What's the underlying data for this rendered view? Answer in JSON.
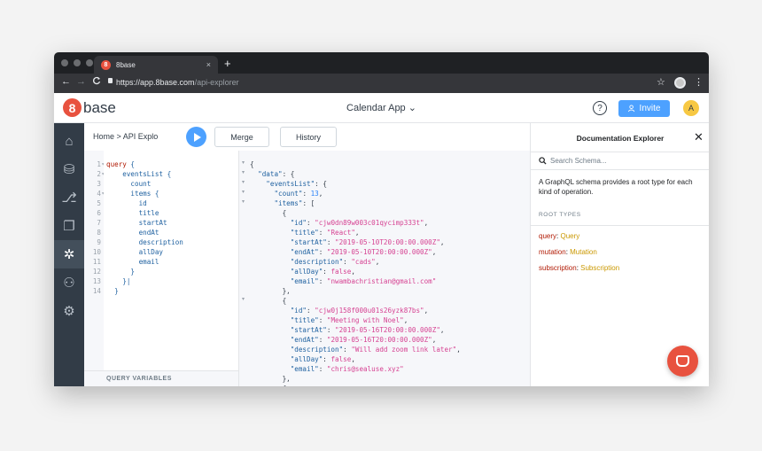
{
  "browser": {
    "tab_title": "8base",
    "tab_close": "×",
    "new_tab": "+",
    "url_host": "https://app.8base.com",
    "url_path": "/api-explorer",
    "back": "←",
    "forward": "→",
    "reload": "C",
    "star": "☆",
    "kebab": "⋮"
  },
  "header": {
    "logo_number": "8",
    "logo_text": "base",
    "app_name": "Calendar App",
    "app_chevron": "⌄",
    "help": "?",
    "invite_label": "Invite",
    "avatar_initial": "A"
  },
  "sidebar": {
    "items": [
      {
        "name": "home",
        "glyph": "⌂"
      },
      {
        "name": "data",
        "glyph": "⛁"
      },
      {
        "name": "logic",
        "glyph": "⎇"
      },
      {
        "name": "apps",
        "glyph": "❐"
      },
      {
        "name": "api-explorer",
        "glyph": "✲"
      },
      {
        "name": "users",
        "glyph": "⚇"
      },
      {
        "name": "settings",
        "glyph": "⚙"
      }
    ]
  },
  "toolbar": {
    "breadcrumb": "Home  >  API Explo",
    "merge_label": "Merge",
    "history_label": "History"
  },
  "editor": {
    "line_numbers": [
      "1",
      "2",
      "3",
      "4",
      "5",
      "6",
      "7",
      "8",
      "9",
      "10",
      "11",
      "12",
      "13",
      "14"
    ],
    "fold_markers": [
      "▾",
      "▾",
      "",
      "▾",
      "",
      "",
      "",
      "",
      "",
      "",
      "",
      "",
      "",
      ""
    ],
    "query_vars_label": "QUERY VARIABLES"
  },
  "result": {
    "gutter": [
      "▾",
      "▾",
      "▾",
      "▾",
      "▾",
      "",
      "",
      "",
      "",
      "",
      "",
      "",
      "",
      "",
      "▾",
      "",
      "",
      "",
      "",
      "",
      "",
      "",
      "",
      ""
    ]
  },
  "docs": {
    "title": "Documentation Explorer",
    "close": "✕",
    "search_placeholder": "Search Schema...",
    "description": "A GraphQL schema provides a root type for each kind of operation.",
    "section": "ROOT TYPES",
    "root_types": [
      {
        "field": "query",
        "type": "Query"
      },
      {
        "field": "mutation",
        "type": "Mutation"
      },
      {
        "field": "subscription",
        "type": "Subscription"
      }
    ]
  }
}
